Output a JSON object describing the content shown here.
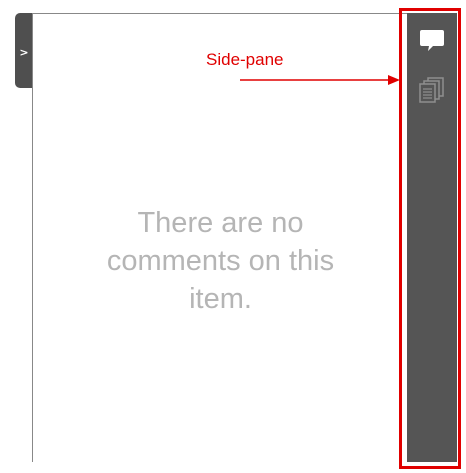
{
  "collapse_tab": {
    "label": ">"
  },
  "comments_panel": {
    "empty_message": "There are no comments on this item."
  },
  "annotation": {
    "label": "Side-pane",
    "color": "#e00000"
  },
  "sidepane": {
    "background": "#555555",
    "buttons": [
      {
        "icon": "speech-bubble-icon",
        "state": "active"
      },
      {
        "icon": "document-stack-icon",
        "state": "inactive"
      }
    ]
  }
}
